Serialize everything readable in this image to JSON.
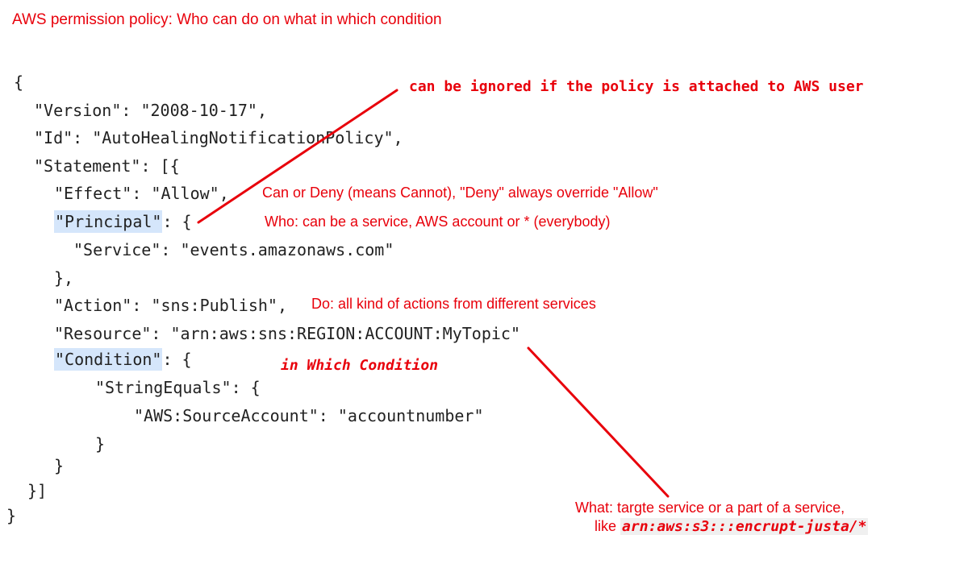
{
  "title": "AWS permission policy: Who can do on what in which condition",
  "code": {
    "open_brace": "{",
    "version_key": "\"Version\"",
    "version_rest": ": \"2008-10-17\",",
    "id_key": "\"Id\"",
    "id_rest": ": \"AutoHealingNotificationPolicy\",",
    "statement_key": "\"Statement\"",
    "statement_rest": ": [{",
    "effect_key": "\"Effect\"",
    "effect_rest": ": \"Allow\",",
    "principal_key": "\"Principal\"",
    "principal_rest": ": {",
    "service_key": "\"Service\"",
    "service_rest": ": \"events.amazonaws.com\"",
    "principal_close": "},",
    "action_key": "\"Action\"",
    "action_rest": ": \"sns:Publish\",",
    "resource_key": "\"Resource\"",
    "resource_rest": ": \"arn:aws:sns:REGION:ACCOUNT:MyTopic\"",
    "condition_key": "\"Condition\"",
    "condition_rest": ": {",
    "stringequals_key": "\"StringEquals\"",
    "stringequals_rest": ": {",
    "sourceaccount_key": "\"AWS:SourceAccount\"",
    "sourceaccount_rest": ": \"accountnumber\"",
    "stringequals_close": "}",
    "condition_close": "}",
    "statement_close": "}]",
    "close_brace": "}"
  },
  "annotations": {
    "ignored_note": "can be ignored if the policy is attached to AWS user",
    "effect_note": "Can or Deny (means Cannot),    \"Deny\" always override \"Allow\"",
    "principal_note": "Who:  can be a service, AWS account or * (everybody)",
    "action_note": "Do: all kind of actions from different services",
    "condition_note": "in Which Condition",
    "resource_note_line1": "What: targte service or a part of a service,",
    "resource_note_like": "like ",
    "resource_note_example": "arn:aws:s3:::encrupt-justa/*"
  },
  "colors": {
    "annotation": "#e8000b",
    "code_text": "#222222",
    "highlight": "#d5e6fb"
  }
}
